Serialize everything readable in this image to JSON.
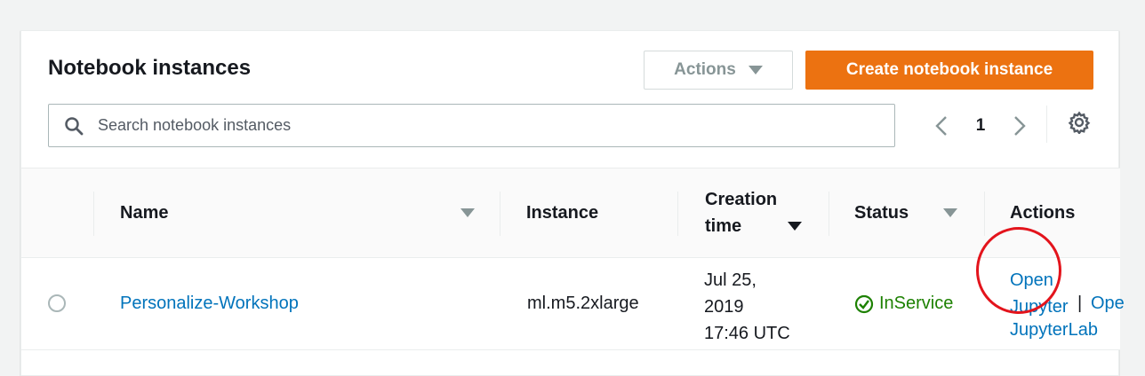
{
  "header": {
    "title": "Notebook instances",
    "actions_label": "Actions",
    "create_label": "Create notebook instance"
  },
  "search": {
    "placeholder": "Search notebook instances",
    "icon": "search-icon"
  },
  "pagination": {
    "current_page": "1"
  },
  "table": {
    "columns": {
      "name": "Name",
      "instance": "Instance",
      "creation_time_line1": "Creation",
      "creation_time_line2": "time",
      "status": "Status",
      "actions": "Actions"
    },
    "rows": [
      {
        "name": "Personalize-Workshop",
        "instance": "ml.m5.2xlarge",
        "created_line1": "Jul 25,",
        "created_line2": "2019",
        "created_line3": "17:46 UTC",
        "status": "InService",
        "open_jupyter_1": "Open",
        "open_jupyter_2": "Jupyter",
        "separator": "|",
        "open_lab_1": "Ope",
        "open_lab_2": "JupyterLab"
      }
    ]
  },
  "colors": {
    "accent": "#ec7211",
    "link": "#0073bb",
    "status_ok": "#1d8102",
    "annotation": "#e3141c"
  }
}
